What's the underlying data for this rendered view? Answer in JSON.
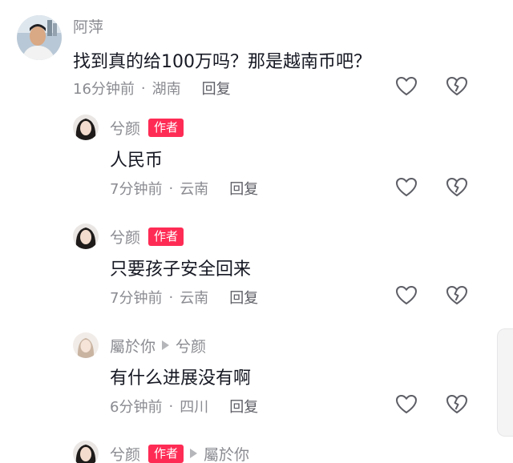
{
  "comments": [
    {
      "name": "阿萍",
      "text": "找到真的给100万吗？那是越南币吧？",
      "time": "16分钟前",
      "location": "湖南",
      "reply": "回复"
    },
    {
      "name": "兮颜",
      "badge": "作者",
      "text": "人民币",
      "time": "7分钟前",
      "location": "云南",
      "reply": "回复"
    },
    {
      "name": "兮颜",
      "badge": "作者",
      "text": "只要孩子安全回来",
      "time": "7分钟前",
      "location": "云南",
      "reply": "回复"
    },
    {
      "name": "屬於你",
      "reply_to": "兮颜",
      "text": "有什么进展没有啊",
      "time": "6分钟前",
      "location": "四川",
      "reply": "回复"
    },
    {
      "name": "兮颜",
      "badge": "作者",
      "reply_to": "屬於你"
    }
  ],
  "separator": "·",
  "icons": {
    "like": "heart-outline-icon",
    "dislike": "broken-heart-icon"
  },
  "colors": {
    "badge": "#fe2c55",
    "muted": "#8a8b91",
    "text": "#161823"
  }
}
